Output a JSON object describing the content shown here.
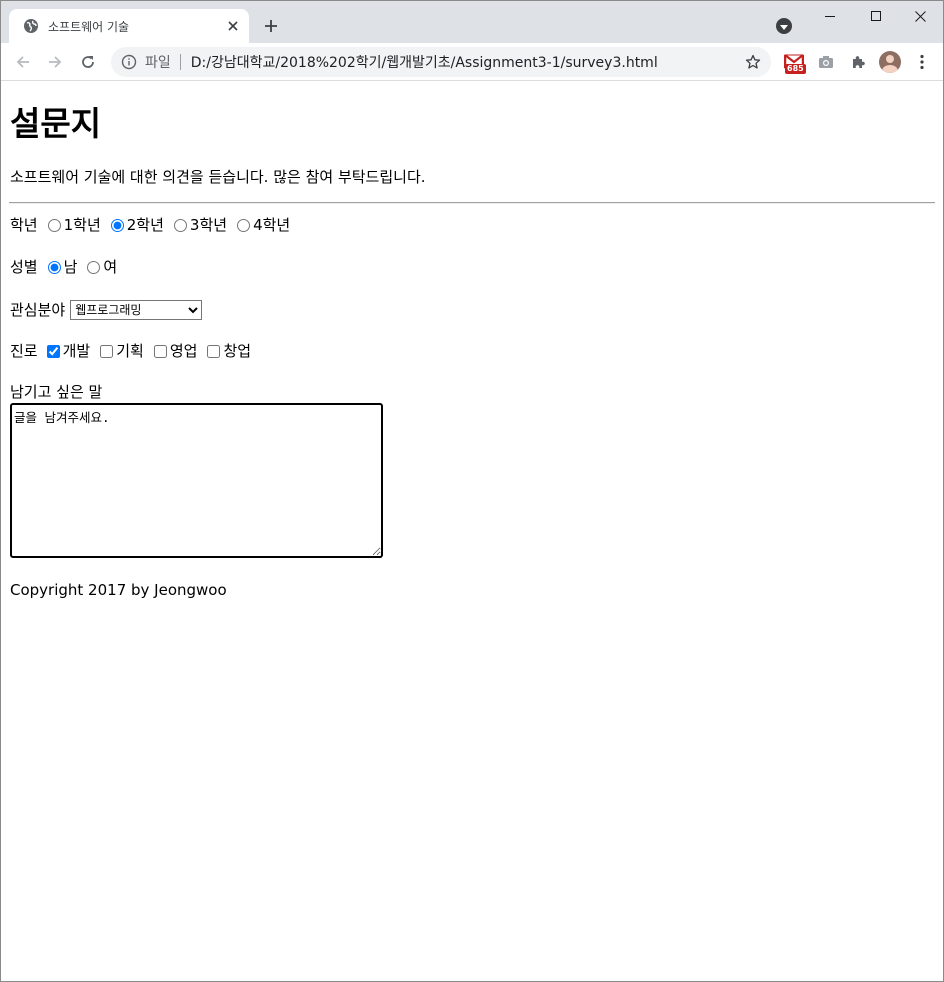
{
  "browser": {
    "tab_title": "소프트웨어 기술",
    "address_scheme": "파일",
    "address_url": "D:/강남대학교/2018%202학기/웹개발기초/Assignment3-1/survey3.html",
    "gmail_badge": "685"
  },
  "page": {
    "heading": "설문지",
    "intro": "소프트웨어 기술에 대한 의견을 듣습니다. 많은 참여 부탁드립니다.",
    "grade": {
      "label": "학년",
      "options": [
        "1학년",
        "2학년",
        "3학년",
        "4학년"
      ],
      "selected": "2학년"
    },
    "gender": {
      "label": "성별",
      "options": [
        "남",
        "여"
      ],
      "selected": "남"
    },
    "interest": {
      "label": "관심분야",
      "selected": "웹프로그래밍"
    },
    "career": {
      "label": "진로",
      "options": [
        "개발",
        "기획",
        "영업",
        "창업"
      ],
      "checked": [
        "개발"
      ]
    },
    "comment": {
      "label": "남기고 싶은 말",
      "value": "글을 남겨주세요."
    },
    "footer": "Copyright 2017 by Jeongwoo"
  },
  "colors": {
    "titlebar_bg": "#dee1e6",
    "omnibox_bg": "#f1f3f4",
    "accent": "#1a73e8",
    "gmail_badge_bg": "#c5221f"
  }
}
